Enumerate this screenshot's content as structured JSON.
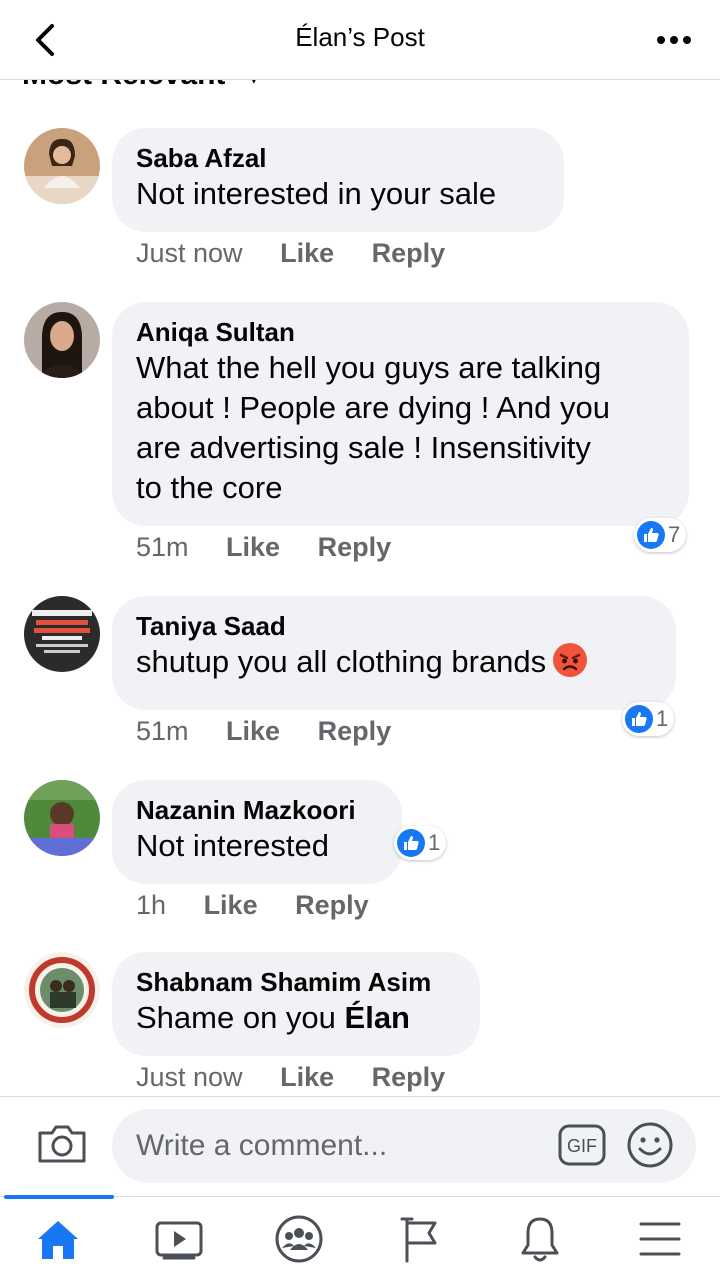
{
  "header": {
    "title": "Élan’s Post",
    "back_icon": "chevron-left-icon",
    "more_icon": "ellipsis-icon"
  },
  "sort": {
    "label": "Most Relevant"
  },
  "comments": [
    {
      "author": "Saba Afzal",
      "lines": [
        "Not interested in your sale"
      ],
      "time": "Just now",
      "like": "Like",
      "reply": "Reply"
    },
    {
      "author": "Aniqa Sultan",
      "lines": [
        "What the hell you guys are talking",
        "about ! People are dying ! And you",
        "are advertising sale ! Insensitivity",
        "to the core"
      ],
      "time": "51m",
      "like": "Like",
      "reply": "Reply",
      "reaction_count": "7"
    },
    {
      "author": "Taniya Saad",
      "lines": [
        "shutup you all clothing brands"
      ],
      "time": "51m",
      "like": "Like",
      "reply": "Reply",
      "reaction_count": "1",
      "emoji": "angry-face-emoji"
    },
    {
      "author": "Nazanin Mazkoori",
      "lines": [
        "Not interested"
      ],
      "time": "1h",
      "like": "Like",
      "reply": "Reply",
      "reaction_count": "1"
    },
    {
      "author": "Shabnam Shamim Asim",
      "text_prefix": "Shame on you ",
      "mention": "Élan",
      "time": "Just now",
      "like": "Like",
      "reply": "Reply"
    }
  ],
  "composer": {
    "placeholder": "Write a comment...",
    "gif_label": "GIF"
  },
  "tabs": [
    "home-icon",
    "video-icon",
    "groups-icon",
    "pages-flag-icon",
    "notifications-bell-icon",
    "menu-icon"
  ],
  "colors": {
    "accent": "#1877f2",
    "bubble": "#f0f2f5",
    "secondary_text": "#65676b",
    "angry_emoji": "#f0543c"
  }
}
